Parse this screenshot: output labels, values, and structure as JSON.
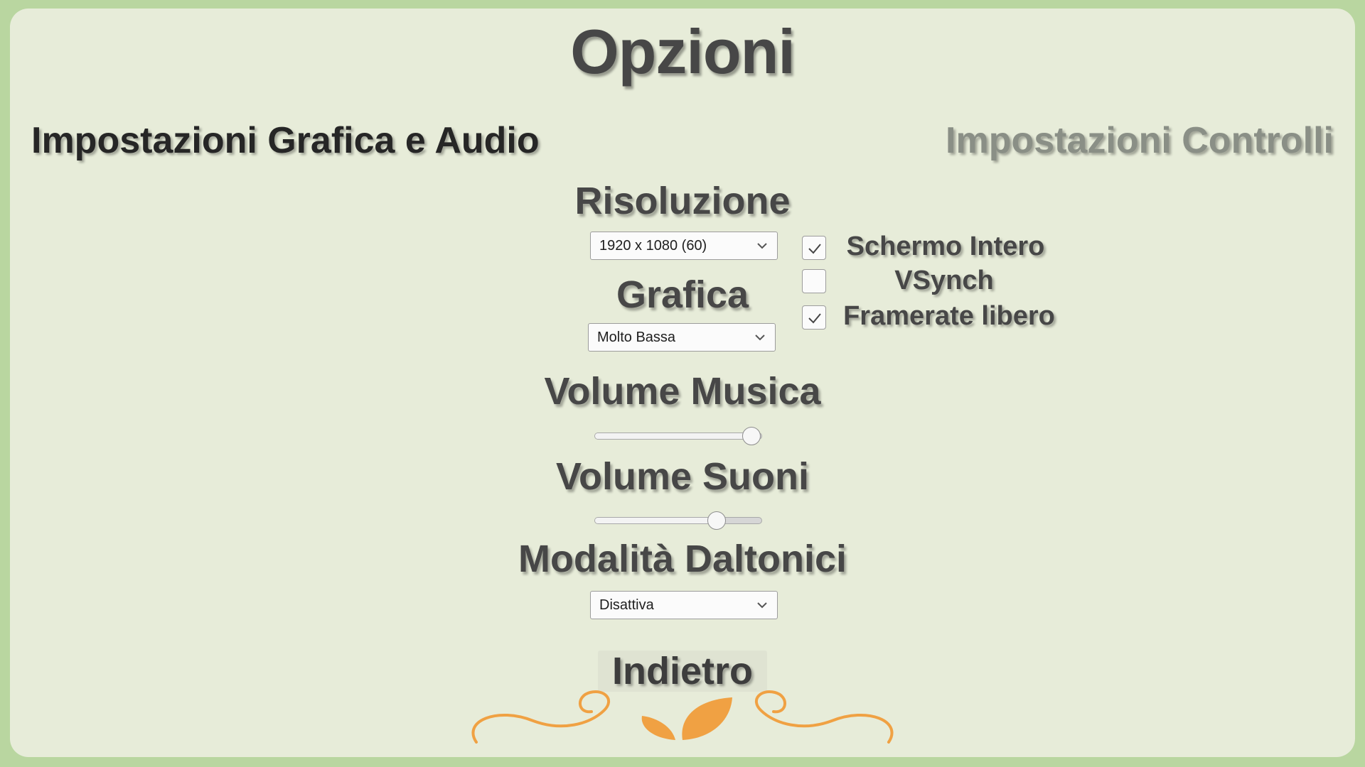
{
  "title": "Opzioni",
  "tabs": {
    "graphics_audio": "Impostazioni Grafica e Audio",
    "controls": "Impostazioni Controlli"
  },
  "resolution": {
    "label": "Risoluzione",
    "value": "1920 x 1080 (60)"
  },
  "graphics": {
    "label": "Grafica",
    "value": "Molto Bassa"
  },
  "checkboxes": [
    {
      "label": "Schermo Intero",
      "checked": true
    },
    {
      "label": "VSynch",
      "checked": false
    },
    {
      "label": "Framerate libero",
      "checked": true
    }
  ],
  "music_volume": {
    "label": "Volume Musica",
    "level": 0.94
  },
  "sound_volume": {
    "label": "Volume Suoni",
    "level": 0.73
  },
  "colorblind": {
    "label": "Modalità Daltonici",
    "value": "Disattiva"
  },
  "back_button": "Indietro",
  "colors": {
    "ornament": "#f0a143",
    "background": "#e7ecd9",
    "frame": "#b9d6a0"
  },
  "icons": {
    "dropdown": "chevron-down-icon",
    "checkbox": "check-icon",
    "ornament": "leaf-swirl-ornament-icon"
  }
}
